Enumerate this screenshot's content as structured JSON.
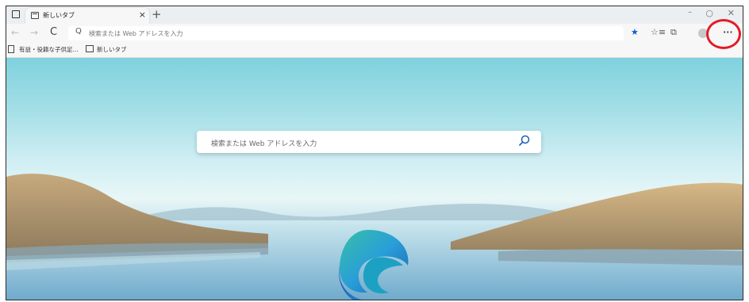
{
  "tab": {
    "title": "新しいタブ",
    "close_glyph": "×"
  },
  "tabstrip": {
    "new_tab_glyph": "+",
    "minimize_glyph": "–",
    "maximize_glyph": "○",
    "close_glyph": "✕"
  },
  "toolbar": {
    "back_glyph": "←",
    "forward_glyph": "→",
    "refresh_glyph": "C",
    "address_placeholder": "検索または Web アドレスを入力",
    "address_icon_glyph": "Q",
    "favorite_glyph": "★",
    "favorites_list_glyph": "☆≡",
    "collections_glyph": "⧉",
    "more_glyph": "···"
  },
  "bookmarks": [
    {
      "label": "有益・役籍な子供足...",
      "icon": "page-icon"
    },
    {
      "label": "新しいタブ",
      "icon": "tab-icon"
    }
  ],
  "search": {
    "placeholder": "検索または Web アドレスを入力",
    "icon": "search-icon"
  },
  "colors": {
    "highlight": "#e21b25",
    "favorite_star": "#0a5fcf"
  }
}
